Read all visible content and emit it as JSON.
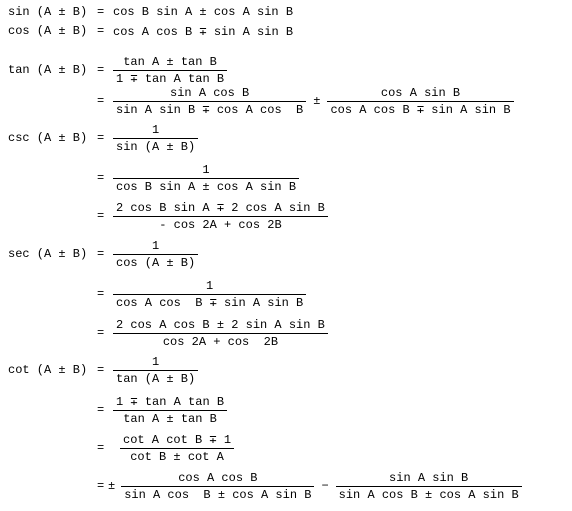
{
  "formulas": [
    {
      "lhs": "sin (A ± B)",
      "eq": "=",
      "text": "cos B sin A ± cos A sin B"
    },
    {
      "lhs": "cos (A ± B)",
      "eq": "=",
      "text": "cos A cos B ∓ sin A sin B"
    },
    {
      "lhs": "tan (A ± B)",
      "eq": "=",
      "terms": [
        {
          "num": "tan A ± tan B",
          "den": "1 ∓ tan A tan B"
        }
      ]
    },
    {
      "eq": "=",
      "terms": [
        {
          "num": "sin A cos B",
          "den": "sin A sin B ∓ cos A cos  B"
        },
        {
          "op": "±"
        },
        {
          "num": "cos A sin B",
          "den": "cos A cos B ∓ sin A sin B"
        }
      ]
    },
    {
      "lhs": "csc (A ± B)",
      "eq": "=",
      "terms": [
        {
          "num": "1",
          "den": "sin (A ± B)"
        }
      ]
    },
    {
      "eq": "=",
      "terms": [
        {
          "num": "1",
          "den": "cos B sin A ± cos A sin B"
        }
      ]
    },
    {
      "eq": "=",
      "terms": [
        {
          "num": "2 cos B sin A ∓ 2 cos A sin B",
          "den": "- cos 2A + cos 2B"
        }
      ]
    },
    {
      "lhs": "sec (A ± B)",
      "eq": "=",
      "terms": [
        {
          "num": "1",
          "den": "cos (A ± B)"
        }
      ]
    },
    {
      "eq": "=",
      "terms": [
        {
          "num": "1",
          "den": "cos A cos  B ∓ sin A sin B"
        }
      ]
    },
    {
      "eq": "=",
      "terms": [
        {
          "num": "2 cos A cos B ± 2 sin A sin B",
          "den": "cos 2A + cos  2B"
        }
      ]
    },
    {
      "lhs": "cot (A ± B)",
      "eq": "=",
      "terms": [
        {
          "num": "1",
          "den": "tan (A ± B)"
        }
      ]
    },
    {
      "eq": "=",
      "terms": [
        {
          "num": "1 ∓ tan A tan B",
          "den": "tan A ± tan B"
        }
      ]
    },
    {
      "eq": "=",
      "terms": [
        {
          "num": "cot A cot B ∓ 1",
          "den": "cot B ± cot A"
        }
      ]
    },
    {
      "eq": "=",
      "prefix": "±",
      "terms": [
        {
          "num": "cos A cos B",
          "den": "sin A cos  B ± cos A sin B"
        },
        {
          "op": "−"
        },
        {
          "num": "sin A sin B",
          "den": "sin A cos B ± cos A sin B"
        }
      ]
    }
  ]
}
